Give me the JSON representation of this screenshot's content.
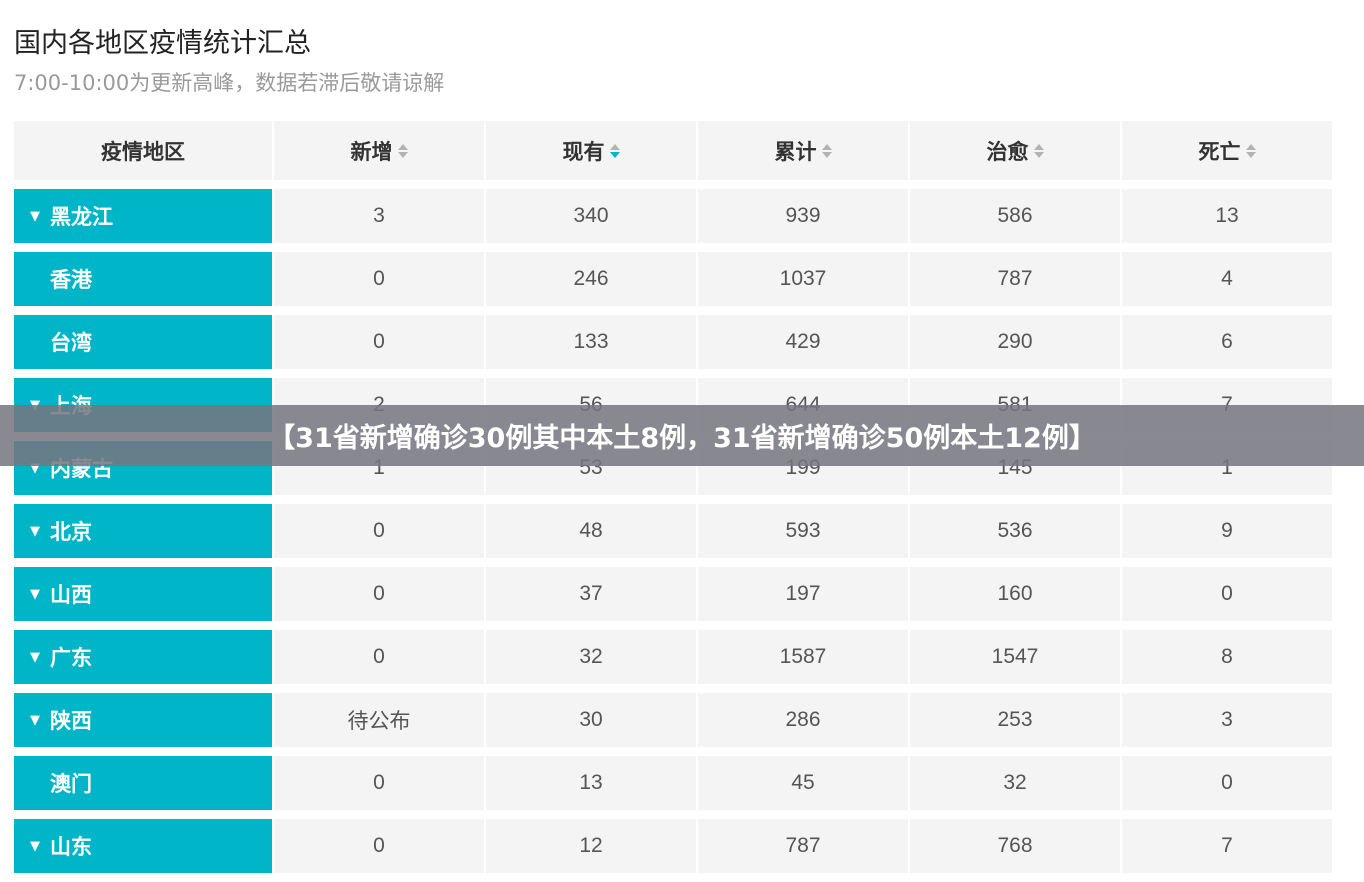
{
  "page": {
    "title": "国内各地区疫情统计汇总",
    "subtitle": "7:00-10:00为更新高峰，数据若滞后敬请谅解"
  },
  "table": {
    "headers": [
      "疫情地区",
      "新增",
      "现有",
      "累计",
      "治愈",
      "死亡"
    ],
    "sort_icon": "sort-icon",
    "active_sort_column": "现有",
    "rows": [
      {
        "region": "黑龙江",
        "expandable": true,
        "new": "3",
        "current": "340",
        "total": "939",
        "cured": "586",
        "deaths": "13"
      },
      {
        "region": "香港",
        "expandable": false,
        "new": "0",
        "current": "246",
        "total": "1037",
        "cured": "787",
        "deaths": "4"
      },
      {
        "region": "台湾",
        "expandable": false,
        "new": "0",
        "current": "133",
        "total": "429",
        "cured": "290",
        "deaths": "6"
      },
      {
        "region": "上海",
        "expandable": true,
        "new": "2",
        "current": "56",
        "total": "644",
        "cured": "581",
        "deaths": "7"
      },
      {
        "region": "内蒙古",
        "expandable": true,
        "new": "1",
        "current": "53",
        "total": "199",
        "cured": "145",
        "deaths": "1"
      },
      {
        "region": "北京",
        "expandable": true,
        "new": "0",
        "current": "48",
        "total": "593",
        "cured": "536",
        "deaths": "9"
      },
      {
        "region": "山西",
        "expandable": true,
        "new": "0",
        "current": "37",
        "total": "197",
        "cured": "160",
        "deaths": "0"
      },
      {
        "region": "广东",
        "expandable": true,
        "new": "0",
        "current": "32",
        "total": "1587",
        "cured": "1547",
        "deaths": "8"
      },
      {
        "region": "陕西",
        "expandable": true,
        "new": "待公布",
        "current": "30",
        "total": "286",
        "cured": "253",
        "deaths": "3"
      },
      {
        "region": "澳门",
        "expandable": false,
        "new": "0",
        "current": "13",
        "total": "45",
        "cured": "32",
        "deaths": "0"
      },
      {
        "region": "山东",
        "expandable": true,
        "new": "0",
        "current": "12",
        "total": "787",
        "cured": "768",
        "deaths": "7"
      }
    ]
  },
  "banner": {
    "text": "【31省新增确诊30例其中本土8例，31省新增确诊50例本土12例】"
  },
  "colors": {
    "accent": "#00b5c8",
    "cell_bg": "#f4f4f5",
    "banner_bg": "#767680"
  }
}
